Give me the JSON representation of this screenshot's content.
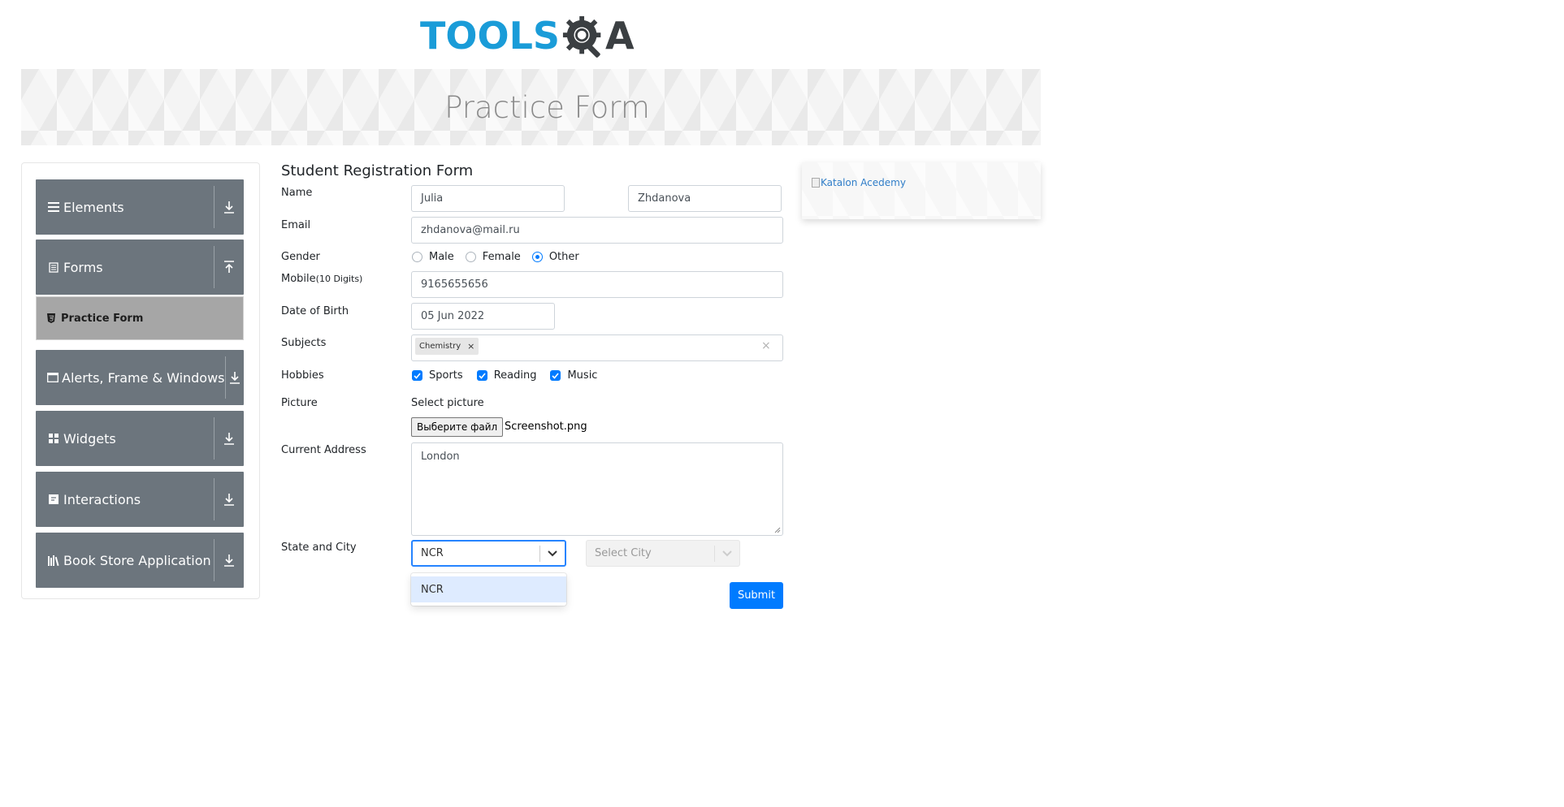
{
  "header": {
    "logo_text": "TOOLS",
    "logo_suffix": "A",
    "colors": {
      "logo_blue": "#1a9cd8",
      "logo_dark": "#3b3f42"
    }
  },
  "banner": {
    "title": "Practice Form"
  },
  "menu": {
    "groups": [
      {
        "label": "Elements",
        "icon": "hamburger-icon",
        "arrow": "download-arrow-icon"
      },
      {
        "label": "Forms",
        "icon": "form-icon",
        "arrow": "upload-arrow-icon"
      },
      {
        "label": "Alerts, Frame & Windows",
        "icon": "window-icon",
        "arrow": "download-arrow-icon"
      },
      {
        "label": "Widgets",
        "icon": "grid-icon",
        "arrow": "download-arrow-icon"
      },
      {
        "label": "Interactions",
        "icon": "interaction-icon",
        "arrow": "download-arrow-icon"
      },
      {
        "label": "Book Store Application",
        "icon": "books-icon",
        "arrow": "download-arrow-icon"
      }
    ],
    "active_item": {
      "label": "Practice Form",
      "icon": "html5-icon"
    },
    "colors": {
      "group_bg": "#6c757d",
      "active_bg": "#a6a6a6"
    }
  },
  "form": {
    "title": "Student Registration Form",
    "labels": {
      "name": "Name",
      "email": "Email",
      "gender": "Gender",
      "mobile": "Mobile",
      "mobile_hint": "(10 Digits)",
      "dob": "Date of Birth",
      "subjects": "Subjects",
      "hobbies": "Hobbies",
      "picture": "Picture",
      "address": "Current Address",
      "state_city": "State and City"
    },
    "first_name": "Julia",
    "last_name": "Zhdanova",
    "email": "zhdanova@mail.ru",
    "gender_options": [
      {
        "label": "Male",
        "checked": false
      },
      {
        "label": "Female",
        "checked": false
      },
      {
        "label": "Other",
        "checked": true
      }
    ],
    "mobile": "9165655656",
    "dob": "05 Jun 2022",
    "subjects": [
      "Chemistry"
    ],
    "subject_remove": "×",
    "subjects_clear": "×",
    "hobbies": [
      {
        "label": "Sports",
        "checked": true
      },
      {
        "label": "Reading",
        "checked": true
      },
      {
        "label": "Music",
        "checked": true
      }
    ],
    "picture_prompt": "Select picture",
    "file_button": "Выберите файл",
    "file_name": "Screenshot.png",
    "address": "London",
    "state_value": "NCR",
    "city_placeholder": "Select City",
    "state_options": [
      "NCR"
    ],
    "submit": "Submit",
    "colors": {
      "primary": "#007bff",
      "focus": "#2684ff",
      "option_highlight": "#deebff"
    }
  },
  "ad": {
    "alt_text": "Katalon Acedemy"
  }
}
